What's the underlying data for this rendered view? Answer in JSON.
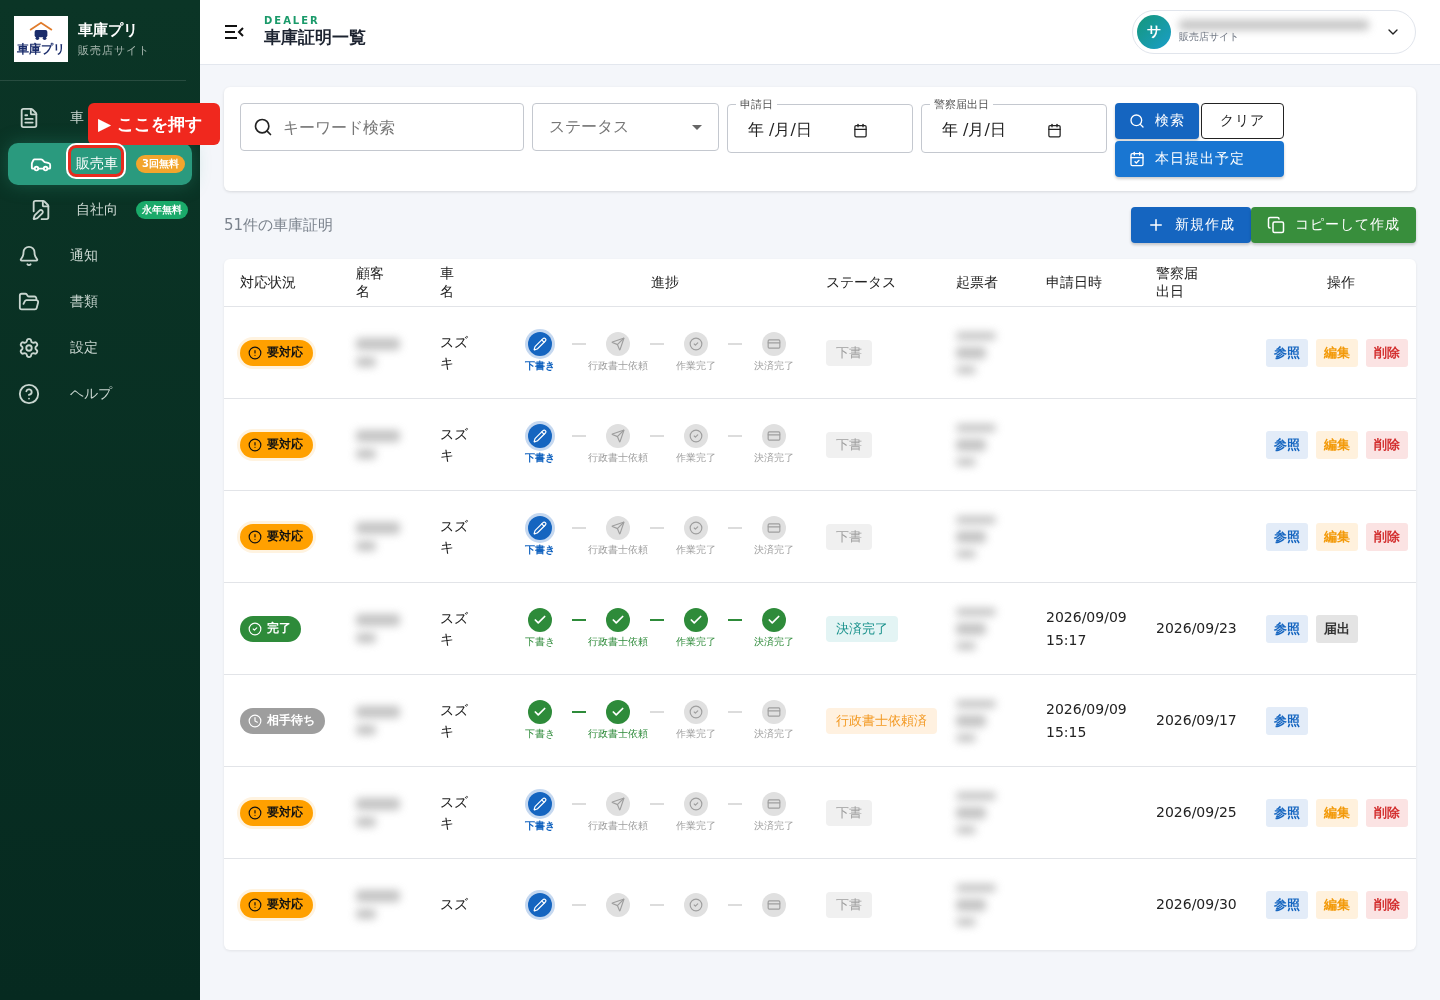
{
  "sidebar": {
    "app_name": "車庫プリ",
    "app_subtitle": "販売店サイト",
    "logo_text": "車庫プリ",
    "items": [
      {
        "label": "車",
        "selected": false,
        "sub": false
      },
      {
        "label": "販売車",
        "selected": true,
        "badge": {
          "text": "3回無料",
          "kind": "trial"
        },
        "sub": true
      },
      {
        "label": "自社向",
        "selected": false,
        "badge": {
          "text": "永年無料",
          "kind": "free"
        },
        "sub": true
      },
      {
        "label": "通知",
        "selected": false,
        "sub": false
      },
      {
        "label": "書類",
        "selected": false,
        "sub": false
      },
      {
        "label": "設定",
        "selected": false,
        "sub": false
      },
      {
        "label": "ヘルプ",
        "selected": false,
        "sub": false
      }
    ],
    "callout": {
      "arrow": "▶",
      "text": "ここを押す"
    }
  },
  "header": {
    "eyebrow": "DEALER",
    "title": "車庫証明一覧",
    "user": {
      "avatar": "サ",
      "role": "販売店サイト"
    }
  },
  "filters": {
    "search_placeholder": "キーワード検索",
    "status_placeholder": "ステータス",
    "dates": [
      {
        "label": "申請日",
        "value": "年 /月/日"
      },
      {
        "label": "警察届出日",
        "value": "年 /月/日"
      }
    ],
    "buttons": [
      {
        "label": "検索",
        "kind": "search"
      },
      {
        "label": "クリア",
        "kind": "clear"
      },
      {
        "label": "本日提出予定",
        "kind": "today"
      }
    ]
  },
  "count": "51件の車庫証明",
  "actions": [
    {
      "label": "新規作成",
      "kind": "new"
    },
    {
      "label": "コピーして作成",
      "kind": "copy"
    }
  ],
  "table": {
    "columns": [
      "対応状況",
      "顧客名",
      "車名",
      "進捗",
      "ステータス",
      "起票者",
      "申請日時",
      "警察届出日",
      "操作"
    ],
    "rows": [
      {
        "state": {
          "label": "要対応",
          "kind": "action"
        },
        "car": "スズキ",
        "steps": [
          {
            "kind": "current",
            "label": "下書き"
          },
          {
            "kind": "pending",
            "label": "行政書士依頼"
          },
          {
            "kind": "pending",
            "label": "作業完了"
          },
          {
            "kind": "pending",
            "label": "決済完了"
          }
        ],
        "status": {
          "label": "下書",
          "kind": "draft"
        },
        "applied": "",
        "police": "",
        "ops": [
          {
            "label": "参照",
            "kind": "view"
          },
          {
            "label": "編集",
            "kind": "edit"
          },
          {
            "label": "削除",
            "kind": "delete"
          }
        ]
      },
      {
        "state": {
          "label": "要対応",
          "kind": "action"
        },
        "car": "スズキ",
        "steps": [
          {
            "kind": "current",
            "label": "下書き"
          },
          {
            "kind": "pending",
            "label": "行政書士依頼"
          },
          {
            "kind": "pending",
            "label": "作業完了"
          },
          {
            "kind": "pending",
            "label": "決済完了"
          }
        ],
        "status": {
          "label": "下書",
          "kind": "draft"
        },
        "applied": "",
        "police": "",
        "ops": [
          {
            "label": "参照",
            "kind": "view"
          },
          {
            "label": "編集",
            "kind": "edit"
          },
          {
            "label": "削除",
            "kind": "delete"
          }
        ]
      },
      {
        "state": {
          "label": "要対応",
          "kind": "action"
        },
        "car": "スズキ",
        "steps": [
          {
            "kind": "current",
            "label": "下書き"
          },
          {
            "kind": "pending",
            "label": "行政書士依頼"
          },
          {
            "kind": "pending",
            "label": "作業完了"
          },
          {
            "kind": "pending",
            "label": "決済完了"
          }
        ],
        "status": {
          "label": "下書",
          "kind": "draft"
        },
        "applied": "",
        "police": "",
        "ops": [
          {
            "label": "参照",
            "kind": "view"
          },
          {
            "label": "編集",
            "kind": "edit"
          },
          {
            "label": "削除",
            "kind": "delete"
          }
        ]
      },
      {
        "state": {
          "label": "完了",
          "kind": "done"
        },
        "car": "スズキ",
        "steps": [
          {
            "kind": "done",
            "label": "下書き"
          },
          {
            "kind": "done",
            "label": "行政書士依頼"
          },
          {
            "kind": "done",
            "label": "作業完了"
          },
          {
            "kind": "done",
            "label": "決済完了"
          }
        ],
        "status": {
          "label": "決済完了",
          "kind": "settled"
        },
        "applied": "2026/09/09 15:17",
        "police": "2026/09/23",
        "ops": [
          {
            "label": "参照",
            "kind": "view"
          },
          {
            "label": "届出",
            "kind": "submit"
          }
        ]
      },
      {
        "state": {
          "label": "相手待ち",
          "kind": "waiting"
        },
        "car": "スズキ",
        "steps": [
          {
            "kind": "done",
            "label": "下書き"
          },
          {
            "kind": "done",
            "label": "行政書士依頼"
          },
          {
            "kind": "pending",
            "label": "作業完了"
          },
          {
            "kind": "pending",
            "label": "決済完了"
          }
        ],
        "status": {
          "label": "行政書士依頼済",
          "kind": "requested"
        },
        "applied": "2026/09/09 15:15",
        "police": "2026/09/17",
        "ops": [
          {
            "label": "参照",
            "kind": "view"
          }
        ]
      },
      {
        "state": {
          "label": "要対応",
          "kind": "action"
        },
        "car": "スズキ",
        "steps": [
          {
            "kind": "current",
            "label": "下書き"
          },
          {
            "kind": "pending",
            "label": "行政書士依頼"
          },
          {
            "kind": "pending",
            "label": "作業完了"
          },
          {
            "kind": "pending",
            "label": "決済完了"
          }
        ],
        "status": {
          "label": "下書",
          "kind": "draft"
        },
        "applied": "",
        "police": "2026/09/25",
        "ops": [
          {
            "label": "参照",
            "kind": "view"
          },
          {
            "label": "編集",
            "kind": "edit"
          },
          {
            "label": "削除",
            "kind": "delete"
          }
        ]
      },
      {
        "state": {
          "label": "要対応",
          "kind": "action"
        },
        "car": "スズ",
        "steps": [
          {
            "kind": "current"
          },
          {
            "kind": "pending"
          },
          {
            "kind": "pending"
          },
          {
            "kind": "pending"
          }
        ],
        "status": {
          "label": "下書",
          "kind": "draft"
        },
        "applied": "",
        "police": "2026/09/30",
        "ops": [
          {
            "label": "参照",
            "kind": "view"
          },
          {
            "label": "編集",
            "kind": "edit"
          },
          {
            "label": "削除",
            "kind": "delete"
          }
        ]
      }
    ]
  }
}
